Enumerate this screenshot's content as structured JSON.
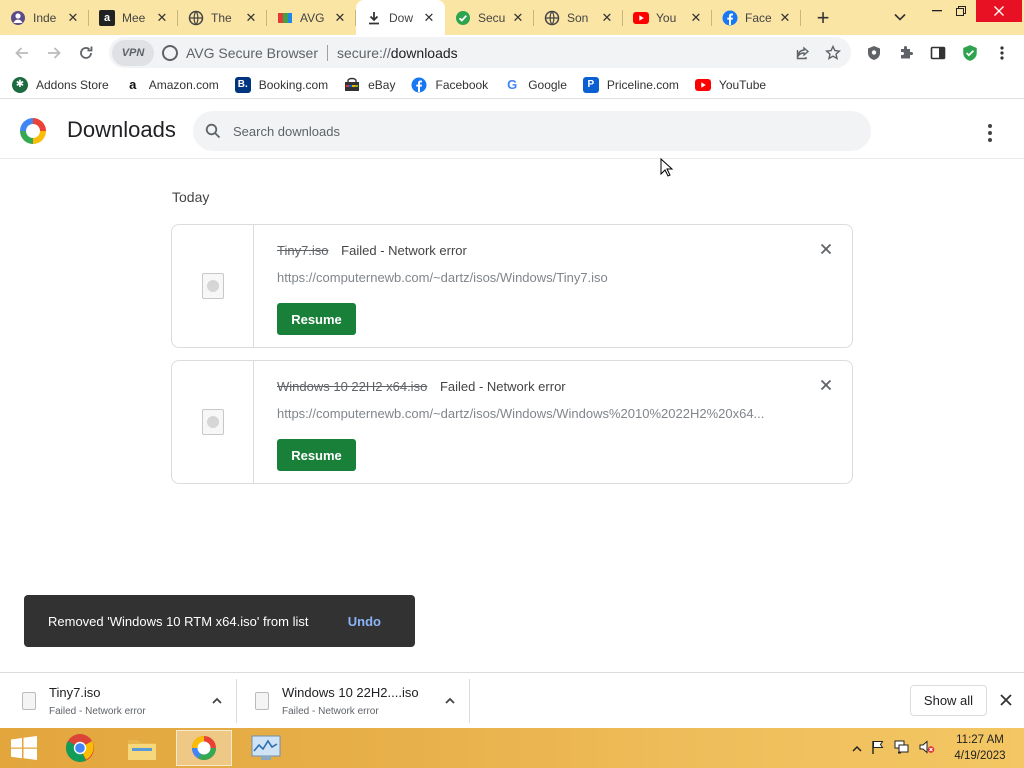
{
  "tabs": [
    {
      "title": "Inde",
      "icon": "user-icon",
      "active": false
    },
    {
      "title": "Mee",
      "icon": "amazon-icon",
      "active": false
    },
    {
      "title": "The",
      "icon": "globe-icon",
      "active": false
    },
    {
      "title": "AVG",
      "icon": "avg-icon",
      "active": false
    },
    {
      "title": "Dow",
      "icon": "download-icon",
      "active": true
    },
    {
      "title": "Secu",
      "icon": "shield-check-icon",
      "active": false
    },
    {
      "title": "Son",
      "icon": "globe-icon",
      "active": false
    },
    {
      "title": "You",
      "icon": "youtube-icon",
      "active": false
    },
    {
      "title": "Face",
      "icon": "facebook-icon",
      "active": false
    }
  ],
  "toolbar": {
    "vpn_label": "VPN",
    "browser_name": "AVG Secure Browser",
    "url_scheme": "secure://",
    "url_path": "downloads"
  },
  "bookmarks": [
    {
      "label": "Addons Store",
      "icon": "addons-icon",
      "color": "#1e7e43"
    },
    {
      "label": "Amazon.com",
      "icon": "amazon-icon",
      "color": "#ffffff"
    },
    {
      "label": "Booking.com",
      "icon": "booking-icon",
      "color": "#003580"
    },
    {
      "label": "eBay",
      "icon": "ebay-icon",
      "color": "#ffffff"
    },
    {
      "label": "Facebook",
      "icon": "facebook-icon",
      "color": "#1877f2"
    },
    {
      "label": "Google",
      "icon": "google-icon",
      "color": "#ffffff"
    },
    {
      "label": "Priceline.com",
      "icon": "priceline-icon",
      "color": "#0a5fd1"
    },
    {
      "label": "YouTube",
      "icon": "youtube-icon",
      "color": "#ff0000"
    }
  ],
  "downloads_page": {
    "title": "Downloads",
    "search_placeholder": "Search downloads",
    "date_group": "Today",
    "items": [
      {
        "filename": "Tiny7.iso",
        "status": "Failed - Network error",
        "url": "https://computernewb.com/~dartz/isos/Windows/Tiny7.iso",
        "action_label": "Resume"
      },
      {
        "filename": "Windows 10 22H2 x64.iso",
        "status": "Failed - Network error",
        "url": "https://computernewb.com/~dartz/isos/Windows/Windows%2010%2022H2%20x64...",
        "action_label": "Resume"
      }
    ]
  },
  "toast": {
    "message": "Removed 'Windows 10 RTM x64.iso' from list",
    "action_label": "Undo"
  },
  "shelf": {
    "items": [
      {
        "name": "Tiny7.iso",
        "status": "Failed - Network error"
      },
      {
        "name": "Windows 10 22H2....iso",
        "status": "Failed - Network error"
      }
    ],
    "show_all_label": "Show all"
  },
  "taskbar": {
    "apps": [
      "chrome-icon",
      "file-explorer-icon",
      "avg-browser-icon",
      "task-manager-icon"
    ],
    "time": "11:27 AM",
    "date": "4/19/2023"
  },
  "colors": {
    "tab_strip": "#fbe5a5",
    "resume_button": "#188038",
    "toast_bg": "#323232",
    "undo_link": "#8ab4f8"
  }
}
